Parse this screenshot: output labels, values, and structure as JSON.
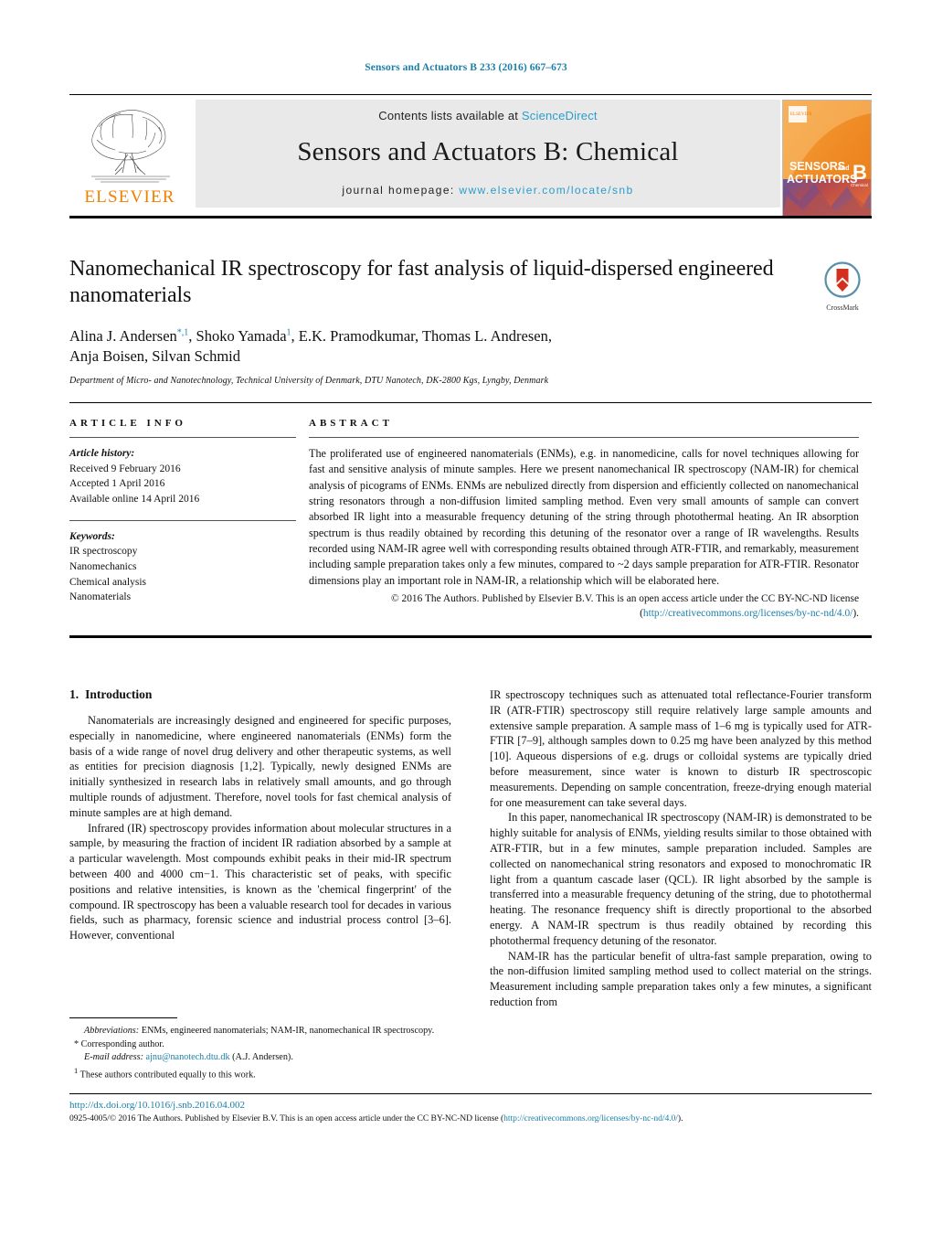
{
  "running_head": "Sensors and Actuators B 233 (2016) 667–673",
  "masthead": {
    "contents_prefix": "Contents lists available at",
    "sciencedirect": "ScienceDirect",
    "journal_title": "Sensors and Actuators B: Chemical",
    "homepage_prefix": "journal homepage:",
    "homepage_url": "www.elsevier.com/locate/snb",
    "publisher_logo_text": "ELSEVIER",
    "cover": {
      "line1": "SENSORS",
      "line1_and": "and",
      "line2": "ACTUATORS",
      "letter": "B",
      "sub": "Chemical"
    }
  },
  "article": {
    "title": "Nanomechanical IR spectroscopy for fast analysis of liquid-dispersed engineered nanomaterials",
    "authors_line1": "Alina J. Andersen",
    "authors_line1_rest": ", Shoko Yamada",
    "authors_line1_rest2": ", E.K. Pramodkumar, Thomas L. Andresen,",
    "authors_line2": "Anja Boisen, Silvan Schmid",
    "affiliation": "Department of Micro- and Nanotechnology, Technical University of Denmark, DTU Nanotech, DK-2800 Kgs, Lyngby, Denmark",
    "crossmark_label": "CrossMark"
  },
  "article_info": {
    "heading": "ARTICLE INFO",
    "history_label": "Article history:",
    "history": [
      "Received 9 February 2016",
      "Accepted 1 April 2016",
      "Available online 14 April 2016"
    ],
    "keywords_label": "Keywords:",
    "keywords": [
      "IR spectroscopy",
      "Nanomechanics",
      "Chemical analysis",
      "Nanomaterials"
    ]
  },
  "abstract": {
    "heading": "ABSTRACT",
    "text": "The proliferated use of engineered nanomaterials (ENMs), e.g. in nanomedicine, calls for novel techniques allowing for fast and sensitive analysis of minute samples. Here we present nanomechanical IR spectroscopy (NAM-IR) for chemical analysis of picograms of ENMs. ENMs are nebulized directly from dispersion and efficiently collected on nanomechanical string resonators through a non-diffusion limited sampling method. Even very small amounts of sample can convert absorbed IR light into a measurable frequency detuning of the string through photothermal heating. An IR absorption spectrum is thus readily obtained by recording this detuning of the resonator over a range of IR wavelengths. Results recorded using NAM-IR agree well with corresponding results obtained through ATR-FTIR, and remarkably, measurement including sample preparation takes only a few minutes, compared to ~2 days sample preparation for ATR-FTIR. Resonator dimensions play an important role in NAM-IR, a relationship which will be elaborated here.",
    "copyright": "© 2016 The Authors. Published by Elsevier B.V. This is an open access article under the CC BY-NC-ND license (",
    "copyright_link": "http://creativecommons.org/licenses/by-nc-nd/4.0/",
    "copyright_end": ")."
  },
  "body": {
    "section_number": "1.",
    "section_title": "Introduction",
    "left_paragraphs": [
      "Nanomaterials are increasingly designed and engineered for specific purposes, especially in nanomedicine, where engineered nanomaterials (ENMs) form the basis of a wide range of novel drug delivery and other therapeutic systems, as well as entities for precision diagnosis [1,2]. Typically, newly designed ENMs are initially synthesized in research labs in relatively small amounts, and go through multiple rounds of adjustment. Therefore, novel tools for fast chemical analysis of minute samples are at high demand.",
      "Infrared (IR) spectroscopy provides information about molecular structures in a sample, by measuring the fraction of incident IR radiation absorbed by a sample at a particular wavelength. Most compounds exhibit peaks in their mid-IR spectrum between 400 and 4000 cm−1. This characteristic set of peaks, with specific positions and relative intensities, is known as the 'chemical fingerprint' of the compound. IR spectroscopy has been a valuable research tool for decades in various fields, such as pharmacy, forensic science and industrial process control [3–6]. However, conventional"
    ],
    "right_paragraphs": [
      "IR spectroscopy techniques such as attenuated total reflectance-Fourier transform IR (ATR-FTIR) spectroscopy still require relatively large sample amounts and extensive sample preparation. A sample mass of 1–6 mg is typically used for ATR-FTIR [7–9], although samples down to 0.25 mg have been analyzed by this method [10]. Aqueous dispersions of e.g. drugs or colloidal systems are typically dried before measurement, since water is known to disturb IR spectroscopic measurements. Depending on sample concentration, freeze-drying enough material for one measurement can take several days.",
      "In this paper, nanomechanical IR spectroscopy (NAM-IR) is demonstrated to be highly suitable for analysis of ENMs, yielding results similar to those obtained with ATR-FTIR, but in a few minutes, sample preparation included. Samples are collected on nanomechanical string resonators and exposed to monochromatic IR light from a quantum cascade laser (QCL). IR light absorbed by the sample is transferred into a measurable frequency detuning of the string, due to photothermal heating. The resonance frequency shift is directly proportional to the absorbed energy. A NAM-IR spectrum is thus readily obtained by recording this photothermal frequency detuning of the resonator.",
      "NAM-IR has the particular benefit of ultra-fast sample preparation, owing to the non-diffusion limited sampling method used to collect material on the strings. Measurement including sample preparation takes only a few minutes, a significant reduction from"
    ]
  },
  "footnotes": {
    "abbrev_label": "Abbreviations:",
    "abbrev_text": "ENMs, engineered nanomaterials; NAM-IR, nanomechanical IR spectroscopy.",
    "corresponding": "Corresponding author.",
    "email_label": "E-mail address:",
    "email": "ajnu@nanotech.dtu.dk",
    "email_owner": "(A.J. Andersen).",
    "equal_contrib": "These authors contributed equally to this work."
  },
  "page_foot": {
    "doi": "http://dx.doi.org/10.1016/j.snb.2016.04.002",
    "issn_start": "0925-4005/© 2016 The Authors. Published by Elsevier B.V. This is an open access article under the CC BY-NC-ND license (",
    "issn_link": "http://creativecommons.org/licenses/by-nc-nd/4.0/",
    "issn_end": ")."
  },
  "colors": {
    "link": "#1b7fa8",
    "sciencedirect": "#2b9ccc",
    "elsevier_orange": "#f08000"
  }
}
